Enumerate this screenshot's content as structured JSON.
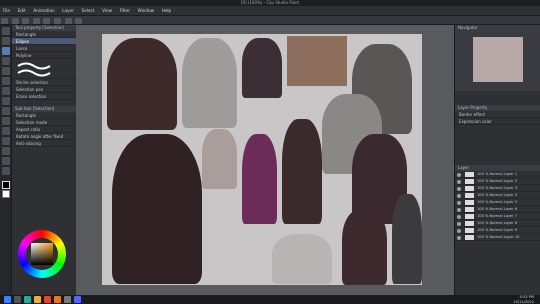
{
  "window": {
    "title": "[0] (100%) - Clip Studio Paint"
  },
  "menu": [
    "File",
    "Edit",
    "Animation",
    "Layer",
    "Select",
    "View",
    "Filter",
    "Window",
    "Help"
  ],
  "tool_property": {
    "header": "Tool property [Selection]",
    "items": [
      "Rectangle",
      "Ellipse",
      "Lasso",
      "Polyline",
      "Shrink selection",
      "Selection pen",
      "Erase selection"
    ],
    "selected": 1
  },
  "sub_tool": {
    "header": "Sub tool [Selection]",
    "rows": [
      "Rectangle",
      "Selection mode",
      "Aspect ratio",
      "Rotate angle after fixed",
      "Anti-aliasing"
    ]
  },
  "navigator": {
    "header": "Navigator"
  },
  "layer_props": {
    "header": "Layer Property",
    "items": [
      "Border effect",
      "Expression color"
    ]
  },
  "layers": {
    "header": "Layer",
    "items": [
      "100 % Normal Layer 1",
      "100 % Normal Layer 2",
      "100 % Normal Layer 3",
      "100 % Normal Layer 4",
      "100 % Normal Layer 5",
      "100 % Normal Layer 6",
      "100 % Normal Layer 7",
      "100 % Normal Layer 8",
      "100 % Normal Layer 9",
      "100 % Normal Layer 10"
    ]
  },
  "taskbar": {
    "time": "4:53 PM",
    "date": "10/11/2022"
  }
}
